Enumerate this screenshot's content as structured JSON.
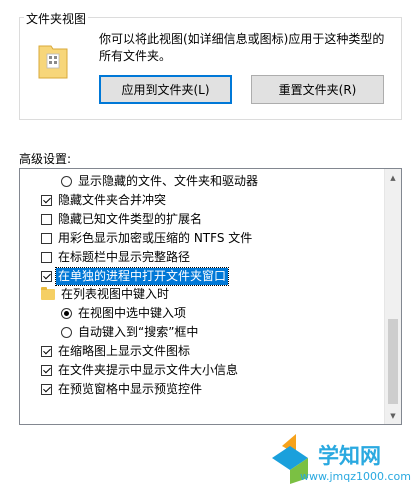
{
  "folder_views": {
    "title": "文件夹视图",
    "description": "你可以将此视图(如详细信息或图标)应用于这种类型的所有文件夹。",
    "apply_button": "应用到文件夹(L)",
    "reset_button": "重置文件夹(R)"
  },
  "advanced": {
    "label": "高级设置:",
    "items": [
      {
        "type": "radio",
        "label": "显示隐藏的文件、文件夹和驱动器",
        "checked": false,
        "indent": 2
      },
      {
        "type": "checkbox",
        "label": "隐藏文件夹合并冲突",
        "checked": true,
        "indent": 1
      },
      {
        "type": "checkbox",
        "label": "隐藏已知文件类型的扩展名",
        "checked": false,
        "indent": 1
      },
      {
        "type": "checkbox",
        "label": "用彩色显示加密或压缩的 NTFS 文件",
        "checked": false,
        "indent": 1
      },
      {
        "type": "checkbox",
        "label": "在标题栏中显示完整路径",
        "checked": false,
        "indent": 1
      },
      {
        "type": "checkbox",
        "label": "在单独的进程中打开文件夹窗口",
        "checked": true,
        "indent": 1,
        "highlighted": true
      },
      {
        "type": "folder",
        "label": "在列表视图中键入时",
        "indent": 1
      },
      {
        "type": "radio",
        "label": "在视图中选中键入项",
        "checked": true,
        "indent": 2
      },
      {
        "type": "radio",
        "label": "自动键入到“搜索”框中",
        "checked": false,
        "indent": 2
      },
      {
        "type": "checkbox",
        "label": "在缩略图上显示文件图标",
        "checked": true,
        "indent": 1
      },
      {
        "type": "checkbox",
        "label": "在文件夹提示中显示文件大小信息",
        "checked": true,
        "indent": 1
      },
      {
        "type": "checkbox",
        "label": "在预览窗格中显示预览控件",
        "checked": true,
        "indent": 1
      }
    ]
  },
  "watermark": {
    "text": "学知网",
    "url": "www.jmqz1000.com"
  }
}
